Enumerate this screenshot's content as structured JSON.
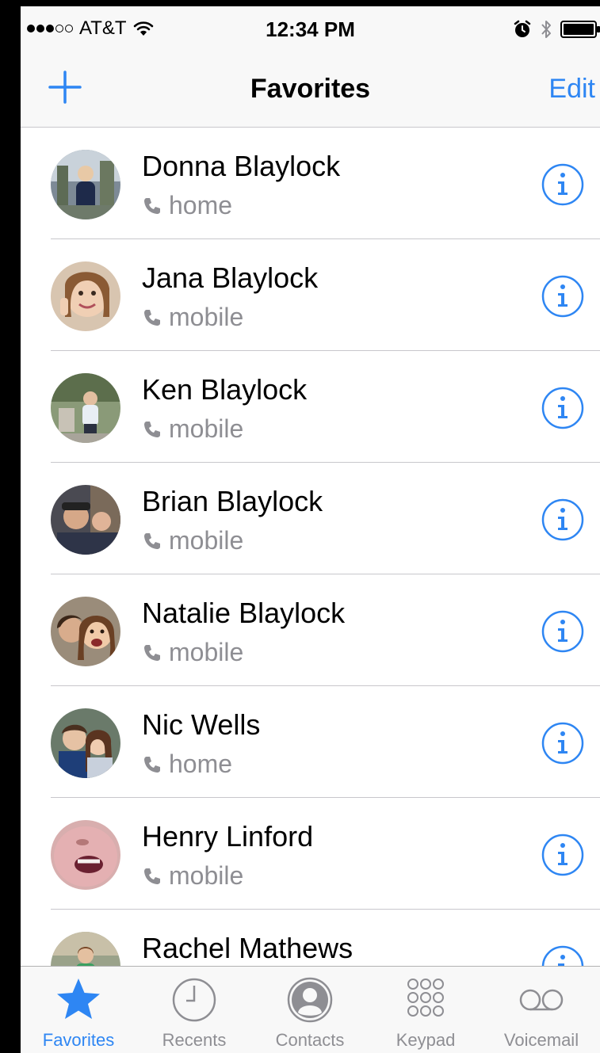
{
  "status_bar": {
    "carrier": "AT&T",
    "time": "12:34 PM"
  },
  "nav": {
    "title": "Favorites",
    "edit_label": "Edit"
  },
  "favorites": [
    {
      "name": "Donna Blaylock",
      "type": "home"
    },
    {
      "name": "Jana Blaylock",
      "type": "mobile"
    },
    {
      "name": "Ken Blaylock",
      "type": "mobile"
    },
    {
      "name": "Brian Blaylock",
      "type": "mobile"
    },
    {
      "name": "Natalie Blaylock",
      "type": "mobile"
    },
    {
      "name": "Nic Wells",
      "type": "home"
    },
    {
      "name": "Henry Linford",
      "type": "mobile"
    },
    {
      "name": "Rachel Mathews",
      "type": ""
    }
  ],
  "tabs": [
    {
      "label": "Favorites",
      "icon": "star-icon"
    },
    {
      "label": "Recents",
      "icon": "clock-icon"
    },
    {
      "label": "Contacts",
      "icon": "person-icon"
    },
    {
      "label": "Keypad",
      "icon": "keypad-icon"
    },
    {
      "label": "Voicemail",
      "icon": "voicemail-icon"
    }
  ],
  "colors": {
    "accent": "#2e86f3",
    "secondary_text": "#8e8e93",
    "bar_background": "#f8f8f8",
    "separator": "#c8c7cc"
  }
}
